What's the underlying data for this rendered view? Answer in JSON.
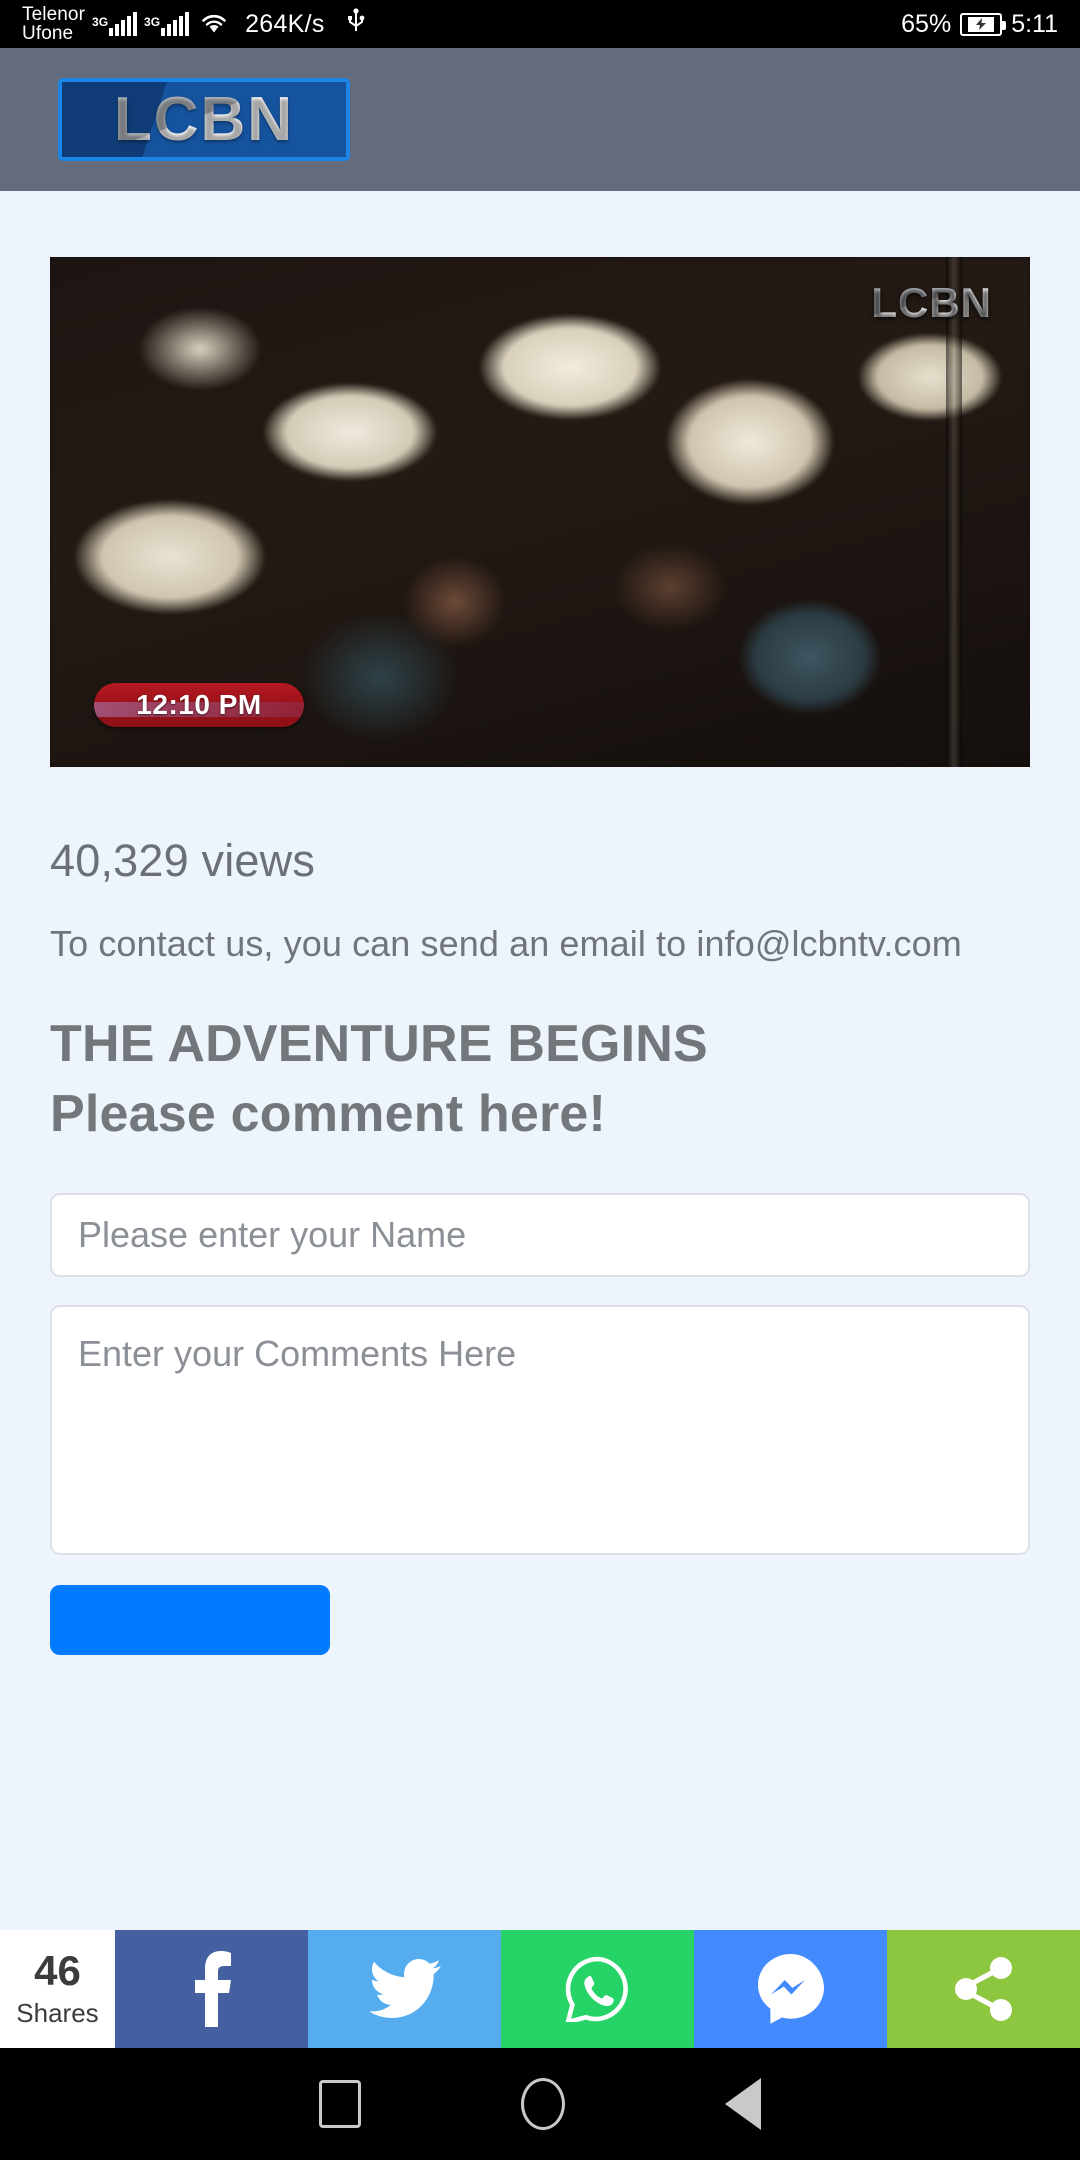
{
  "statusbar": {
    "carrier_1": "Telenor",
    "carrier_2": "Ufone",
    "network_1": "3G",
    "network_2": "3G",
    "wifi_icon": "wifi-icon",
    "data_speed": "264K/s",
    "usb_icon": "usb-icon",
    "battery_percent": "65%",
    "battery_icon": "battery-charging-icon",
    "clock": "5:11"
  },
  "header": {
    "logo_text": "LCBN"
  },
  "player": {
    "watermark": "LCBN",
    "timestamp_badge": "12:10 PM"
  },
  "article": {
    "views": "40,329 views",
    "contact_line": "To contact us, you can send an email to info@lcbntv.com",
    "heading_line_1": "THE ADVENTURE BEGINS",
    "heading_line_2": "Please comment here!"
  },
  "form": {
    "name_placeholder": "Please enter your Name",
    "name_value": "",
    "comments_placeholder": "Enter your Comments Here",
    "comments_value": "",
    "submit_label": ""
  },
  "sharebar": {
    "count": "46",
    "count_label": "Shares",
    "buttons": [
      {
        "name": "facebook",
        "icon": "facebook-icon",
        "color": "#4460a0"
      },
      {
        "name": "twitter",
        "icon": "twitter-icon",
        "color": "#55acee"
      },
      {
        "name": "whatsapp",
        "icon": "whatsapp-icon",
        "color": "#25d366"
      },
      {
        "name": "messenger",
        "icon": "messenger-icon",
        "color": "#448aff"
      },
      {
        "name": "share",
        "icon": "share-nodes-icon",
        "color": "#8dc63f"
      }
    ]
  },
  "navbar": {
    "recents": "recents-square-icon",
    "home": "home-circle-icon",
    "back": "back-triangle-icon"
  },
  "colors": {
    "header_bg": "#636b7d",
    "page_bg": "#eef4fc",
    "logo_border": "#1b86e8",
    "submit_blue": "#007bff",
    "text_gray": "#6f757b"
  }
}
